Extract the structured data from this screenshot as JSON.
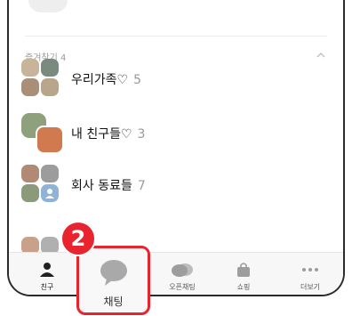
{
  "favorites": {
    "title": "즐겨찾기 4",
    "items": [
      {
        "name": "우리가족♡",
        "count": "5"
      },
      {
        "name": "내 친구들♡",
        "count": "3"
      },
      {
        "name": "회사 동료들",
        "count": "7"
      }
    ]
  },
  "step_marker": "2",
  "tabs": [
    {
      "label": "친구",
      "icon": "person-icon",
      "active": true
    },
    {
      "label": "채팅",
      "icon": "chat-bubble-icon",
      "active": false
    },
    {
      "label": "오픈채팅",
      "icon": "open-chat-icon",
      "active": false
    },
    {
      "label": "쇼핑",
      "icon": "shopping-bag-icon",
      "active": false
    },
    {
      "label": "더보기",
      "icon": "more-icon",
      "active": false
    }
  ],
  "colors": {
    "highlight": "#e8242e",
    "tab_bg": "#f7f7f7"
  }
}
